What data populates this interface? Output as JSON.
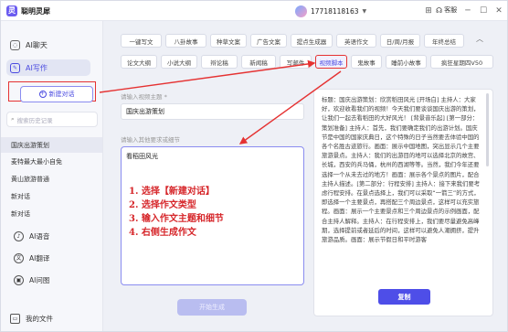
{
  "app": {
    "name": "聪明灵犀",
    "logo_char": "灵",
    "user": "17718118163",
    "kefu": "客服"
  },
  "sidebar": {
    "nav": [
      {
        "label": "AI聊天"
      },
      {
        "label": "AI写作"
      }
    ],
    "new_chat": "新建对话",
    "search_placeholder": "搜索历史记录",
    "history": [
      "国庆出游策划",
      "麦特最大最小自免",
      "黄山旅游普通",
      "新对话",
      "新对话"
    ],
    "tools": [
      {
        "label": "AI语音"
      },
      {
        "label": "AI翻译"
      },
      {
        "label": "AI问图"
      }
    ],
    "files": "我的文件"
  },
  "types_row1": [
    "一键写文",
    "八卦故事",
    "种草文案",
    "广告文案",
    "提点生成器",
    "英语作文",
    "日/周/月报",
    "年终总结"
  ],
  "types_row2": [
    "论文大纲",
    "小说大纲",
    "辩论稿",
    "新闻稿",
    "写邮件",
    "视频脚本",
    "鬼故事",
    "睡前小故事",
    "疯狂星期四V50"
  ],
  "form": {
    "topic_label": "请输入视频主题 *",
    "topic_value": "国庆出游策划",
    "detail_label": "请输入其他要求或细节",
    "detail_value": "看稻田风光",
    "generate": "开始生成"
  },
  "instructions": [
    "1. 选择【新建对话】",
    "2. 选择作文类型",
    "3. 输入作文主题和细节",
    "4. 右侧生成作文"
  ],
  "output": {
    "text": "标题：国庆出游策划：欣赏稻田风光 [开场白] 主持人：大家好，欢迎收看我们的视频！今天我们要谈谈国庆出游的策划，让我们一起去看稻田的大好风光！ [背景音乐起] [第一部分：策划准备] 主持人：首先，我们要确定我们的出游计划。国庆节是中国的国家庆典日，这个特殊的日子当然要去体验中国的各个名胜古迹旅行。画面：展示中国地图，突出显示几个主要旅游景点。主持人：我们的出游目的地可以选择北京的故宫、长城，西安的兵马俑，杭州的西湖等等。当然，我们今年还要选择一个从未去过的地方！画面：展示各个景点的图片，配合主持人描述。[第二部分：行程安排] 主持人：接下来我们要考虑行程安排。在景点选择上，我们可以采取“一箭三”的方式，即选择一个主要景点，再搭配三个周边景点，这样可以充实旅程。画面：展示一个主要景点和三个周边景点的示例画面，配合主持人解释。主持人：在行程安排上，我们要尽量避免高峰期，选择提前或者延后的时间，这样可以避免人潮拥挤，提升旅游品质。画面：展示节假日和平时游客",
    "copy": "复制"
  },
  "colors": {
    "accent": "#4e4ee8",
    "annotation": "#e53232"
  }
}
